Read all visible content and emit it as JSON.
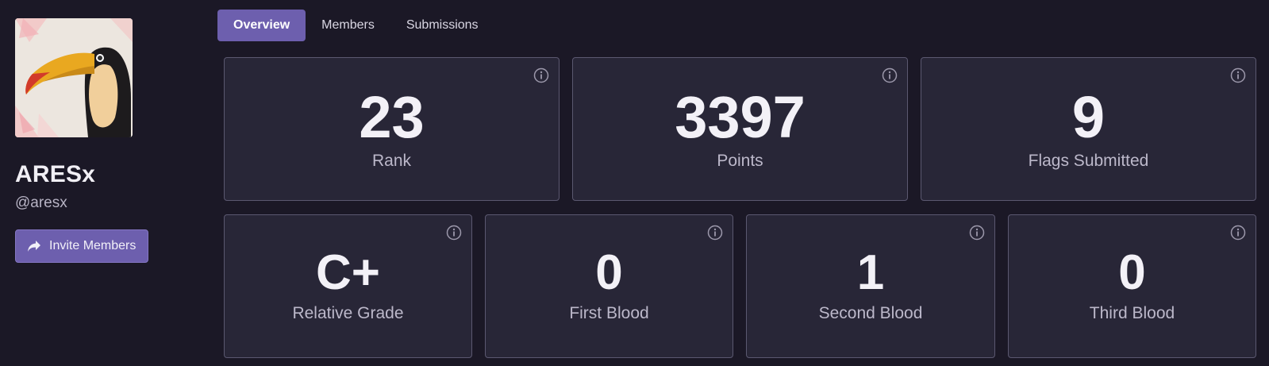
{
  "team": {
    "name": "ARESx",
    "handle": "@aresx",
    "invite_label": "Invite Members"
  },
  "tabs": [
    {
      "label": "Overview",
      "active": true
    },
    {
      "label": "Members",
      "active": false
    },
    {
      "label": "Submissions",
      "active": false
    }
  ],
  "stats": {
    "rank": {
      "value": "23",
      "label": "Rank"
    },
    "points": {
      "value": "3397",
      "label": "Points"
    },
    "flags": {
      "value": "9",
      "label": "Flags Submitted"
    },
    "grade": {
      "value": "C+",
      "label": "Relative Grade"
    },
    "first_blood": {
      "value": "0",
      "label": "First Blood"
    },
    "second_blood": {
      "value": "1",
      "label": "Second Blood"
    },
    "third_blood": {
      "value": "0",
      "label": "Third Blood"
    }
  },
  "icons": {
    "avatar": "toucan-avatar",
    "invite": "share-arrow-icon",
    "info": "info-icon"
  },
  "colors": {
    "background": "#1b1826",
    "card": "#282637",
    "card_border": "#5b5870",
    "accent": "#6d5fae"
  }
}
